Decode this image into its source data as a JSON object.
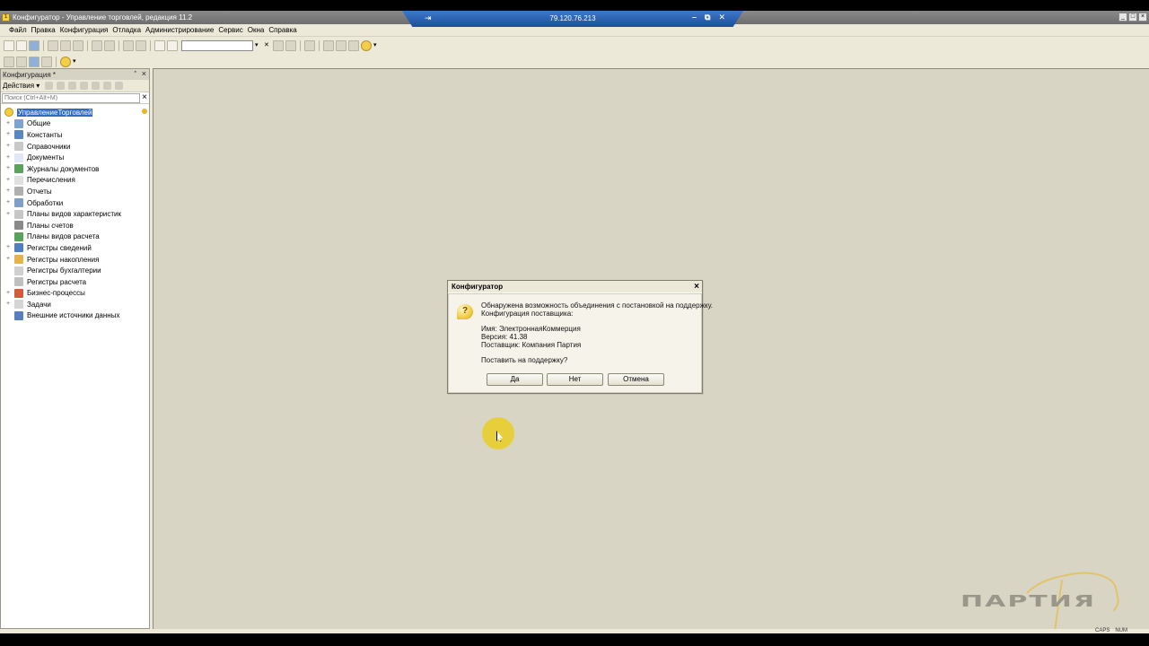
{
  "window": {
    "title": "Конфигуратор - Управление торговлей, редакция 11.2",
    "app_icon_letter": "1"
  },
  "remote_session": {
    "host": "79.120.76.213"
  },
  "menu": [
    "Файл",
    "Правка",
    "Конфигурация",
    "Отладка",
    "Администрирование",
    "Сервис",
    "Окна",
    "Справка"
  ],
  "panel": {
    "title": "Конфигурация *",
    "actions_label": "Действия",
    "search_placeholder": "Поиск (Ctrl+Alt+M)",
    "tree": [
      {
        "label": "УправлениеТорговлей",
        "expand": "",
        "color": "#f2cf3a",
        "root": true
      },
      {
        "label": "Общие",
        "expand": "+",
        "color": "#7fa3cf"
      },
      {
        "label": "Константы",
        "expand": "+",
        "color": "#5a86c2"
      },
      {
        "label": "Справочники",
        "expand": "+",
        "color": "#c8c8c8"
      },
      {
        "label": "Документы",
        "expand": "+",
        "color": "#dfe8f4"
      },
      {
        "label": "Журналы документов",
        "expand": "+",
        "color": "#5aa35a"
      },
      {
        "label": "Перечисления",
        "expand": "+",
        "color": "#e0e0e0"
      },
      {
        "label": "Отчеты",
        "expand": "+",
        "color": "#b0b0b0"
      },
      {
        "label": "Обработки",
        "expand": "+",
        "color": "#7f9fc9"
      },
      {
        "label": "Планы видов характеристик",
        "expand": "+",
        "color": "#c6c6c6"
      },
      {
        "label": "Планы счетов",
        "expand": "",
        "color": "#8a8a8a"
      },
      {
        "label": "Планы видов расчета",
        "expand": "",
        "color": "#5aa35a"
      },
      {
        "label": "Регистры сведений",
        "expand": "+",
        "color": "#4f7fbf"
      },
      {
        "label": "Регистры накопления",
        "expand": "+",
        "color": "#e6b34a"
      },
      {
        "label": "Регистры бухгалтерии",
        "expand": "",
        "color": "#d0d0d0"
      },
      {
        "label": "Регистры расчета",
        "expand": "",
        "color": "#c0c0c0"
      },
      {
        "label": "Бизнес-процессы",
        "expand": "+",
        "color": "#d65a3a"
      },
      {
        "label": "Задачи",
        "expand": "+",
        "color": "#d5d5d5"
      },
      {
        "label": "Внешние источники данных",
        "expand": "",
        "color": "#5a7fc0"
      }
    ]
  },
  "dialog": {
    "title": "Конфигуратор",
    "icon": "?",
    "lines": [
      "Обнаружена возможность объединения с постановкой на поддержку.",
      "Конфигурация поставщика:",
      "Имя: ЭлектроннаяКоммерция",
      "Версия: 41.38",
      "Поставщик: Компания Партия",
      "Поставить на поддержку?"
    ],
    "buttons": {
      "yes": "Да",
      "no": "Нет",
      "cancel": "Отмена"
    }
  },
  "watermark": {
    "text": "ПАРТИЯ"
  },
  "statusbar": {
    "caps": "CAPS",
    "num": "NUM"
  }
}
